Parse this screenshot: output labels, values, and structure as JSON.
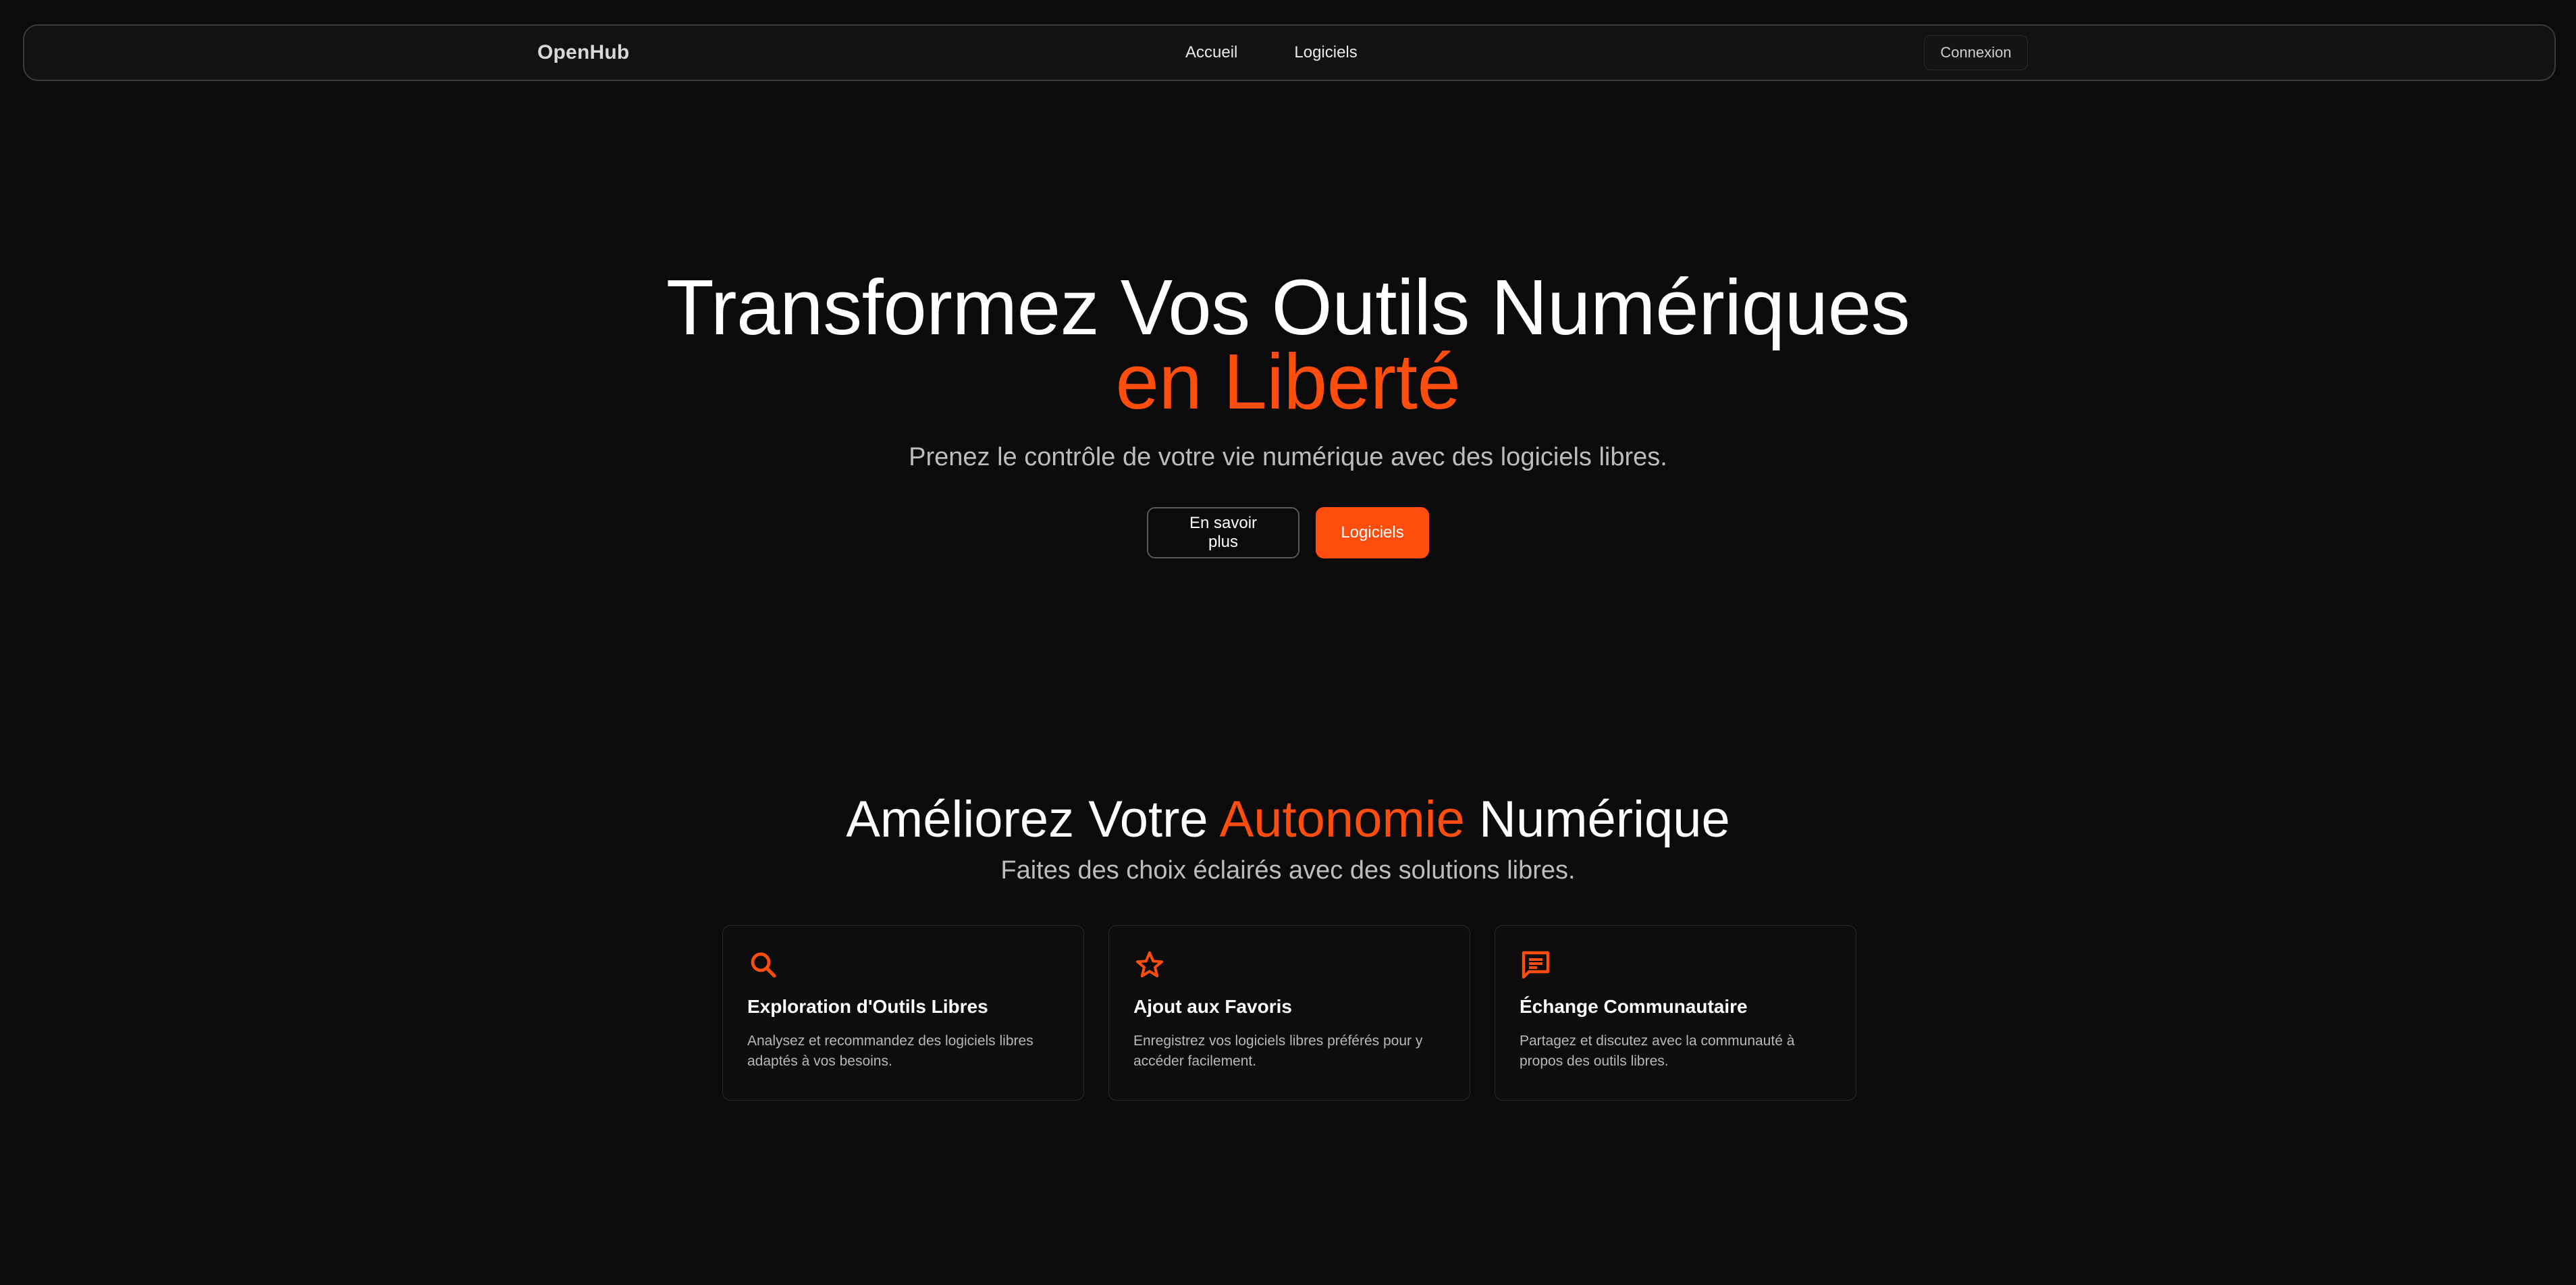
{
  "nav": {
    "brand": "OpenHub",
    "links": [
      {
        "label": "Accueil"
      },
      {
        "label": "Logiciels"
      }
    ],
    "login_label": "Connexion"
  },
  "hero": {
    "title_line1": "Transformez Vos Outils Numériques",
    "title_line2": "en Liberté",
    "subtitle": "Prenez le contrôle de votre vie numérique avec des logiciels libres.",
    "secondary_button": "En savoir plus",
    "primary_button": "Logiciels"
  },
  "features": {
    "title_part1": "Améliorez Votre ",
    "title_accent": "Autonomie",
    "title_part2": " Numérique",
    "subtitle": "Faites des choix éclairés avec des solutions libres.",
    "cards": [
      {
        "icon": "search-icon",
        "title": "Exploration d'Outils Libres",
        "text": "Analysez et recommandez des logiciels libres adaptés à vos besoins."
      },
      {
        "icon": "star-icon",
        "title": "Ajout aux Favoris",
        "text": "Enregistrez vos logiciels libres préférés pour y accéder facilement."
      },
      {
        "icon": "chat-icon",
        "title": "Échange Communautaire",
        "text": "Partagez et discutez avec la communauté à propos des outils libres."
      }
    ]
  },
  "colors": {
    "accent": "#ff4d0d",
    "background": "#0b0b0b"
  }
}
